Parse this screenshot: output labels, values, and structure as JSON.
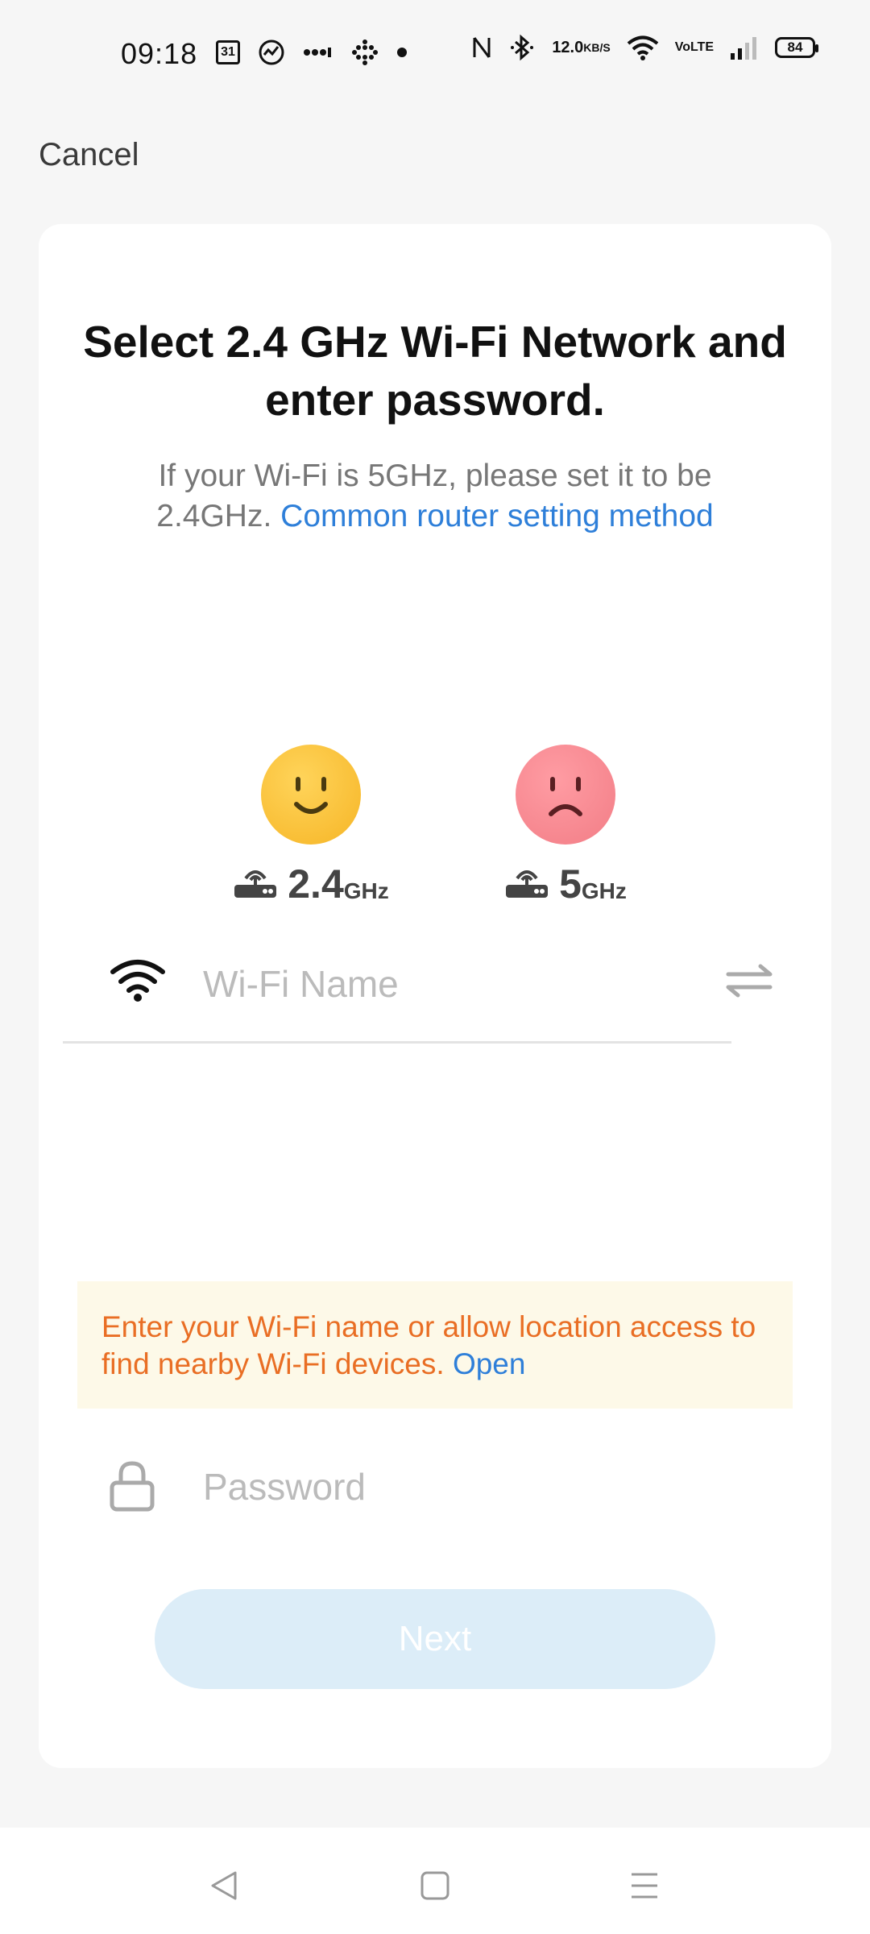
{
  "status_bar": {
    "time": "09:18",
    "calendar_day": "31",
    "net_speed_value": "12.0",
    "net_speed_unit": "KB/S",
    "volte_top": "Vo",
    "volte_bottom": "LTE",
    "battery": "84",
    "icons": [
      "calendar-icon",
      "activity-icon",
      "more-dots-icon",
      "grid-dots-icon",
      "notification-dot-icon",
      "nfc-icon",
      "bluetooth-icon",
      "wifi-signal-icon",
      "cellular-signal-icon",
      "battery-icon"
    ]
  },
  "header": {
    "cancel_label": "Cancel"
  },
  "main": {
    "title": "Select 2.4 GHz Wi-Fi Network and enter password.",
    "subtitle_text": "If your Wi-Fi is 5GHz, please set it to be 2.4GHz.",
    "subtitle_link": "Common router setting method",
    "bands": {
      "supported": {
        "number": "2.4",
        "unit": "GHz",
        "face": "happy-face-icon",
        "router_icon": "router-icon"
      },
      "unsupported": {
        "number": "5",
        "unit": "GHz",
        "face": "sad-face-icon",
        "router_icon": "router-icon"
      }
    },
    "wifi": {
      "placeholder": "Wi-Fi Name",
      "value": "",
      "icon": "wifi-icon",
      "switch_icon": "switch-arrows-icon"
    },
    "warning": {
      "text": "Enter your Wi-Fi name or allow location access to find nearby Wi-Fi devices.",
      "link": "Open"
    },
    "password": {
      "placeholder": "Password",
      "value": "",
      "icon": "lock-icon"
    },
    "next_label": "Next"
  },
  "nav_bar": {
    "buttons": [
      "back-icon",
      "home-icon",
      "menu-icon"
    ]
  },
  "colors": {
    "link": "#2e7fd9",
    "warning_text": "#e96e24",
    "warning_bg": "#fdf9e8",
    "button_disabled_bg": "#dcedf8",
    "happy_face": "#f9c23c",
    "sad_face": "#f4858e"
  }
}
